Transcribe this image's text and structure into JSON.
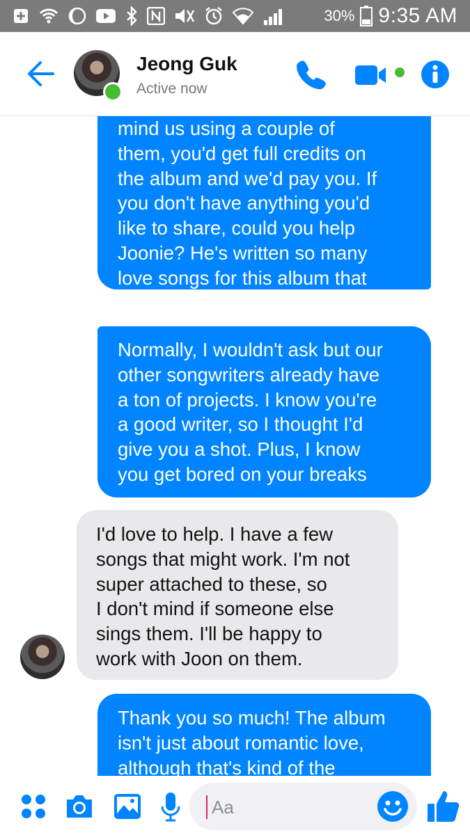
{
  "status_bar": {
    "battery": "30%",
    "time": "9:35 AM"
  },
  "header": {
    "contact_name": "Jeong Guk",
    "status": "Active now"
  },
  "messages": [
    {
      "sender": "me",
      "text": "mind us using a couple of\nthem, you'd get full credits on\nthe album and we'd pay you. If\nyou don't have anything you'd\nlike to share, could you help\nJoonie? He's written so many\nlove songs for this album that\nhe's kind of tapped out"
    },
    {
      "sender": "me",
      "text": "Normally, I wouldn't ask but our\nother songwriters already have\na ton of projects. I know you're\na good writer, so I thought I'd\ngive you a shot. Plus, I know\nyou get bored on your breaks"
    },
    {
      "sender": "Jeong Guk",
      "text": "I'd love to help. I have a few\nsongs that might work. I'm not\nsuper attached to these, so\nI don't mind if someone else\nsings them. I'll be happy to\nwork with Joon on them."
    },
    {
      "sender": "me",
      "text": "Thank you so much! The album\nisn't just about romantic love,\nalthough that's kind of the"
    }
  ],
  "composer": {
    "placeholder": "Aa"
  },
  "colors": {
    "accent": "#0084ff",
    "incoming_bubble": "#e9e9eb",
    "active": "#44bd32",
    "status_bar": "#7b7b7b"
  },
  "icons": [
    "back-arrow-icon",
    "phone-icon",
    "video-camera-icon",
    "info-icon",
    "apps-grid-icon",
    "camera-icon",
    "gallery-icon",
    "microphone-icon",
    "emoji-icon",
    "thumbs-up-icon"
  ]
}
